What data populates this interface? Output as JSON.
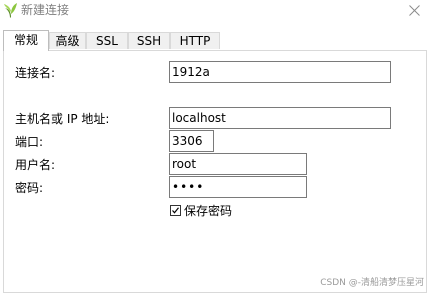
{
  "window": {
    "title": "新建连接",
    "app_icon": "navicat-leaf-icon",
    "close_icon": "close-icon"
  },
  "tabs": [
    {
      "label": "常规",
      "active": true
    },
    {
      "label": "高级",
      "active": false
    },
    {
      "label": "SSL",
      "active": false
    },
    {
      "label": "SSH",
      "active": false
    },
    {
      "label": "HTTP",
      "active": false
    }
  ],
  "form": {
    "connection_name": {
      "label": "连接名:",
      "value": "1912a"
    },
    "host": {
      "label": "主机名或 IP 地址:",
      "value": "localhost"
    },
    "port": {
      "label": "端口:",
      "value": "3306"
    },
    "username": {
      "label": "用户名:",
      "value": "root"
    },
    "password": {
      "label": "密码:",
      "value": "••••"
    },
    "save_password": {
      "label": "保存密码",
      "checked": true
    }
  },
  "watermark": "CSDN @-清船清梦压星河"
}
